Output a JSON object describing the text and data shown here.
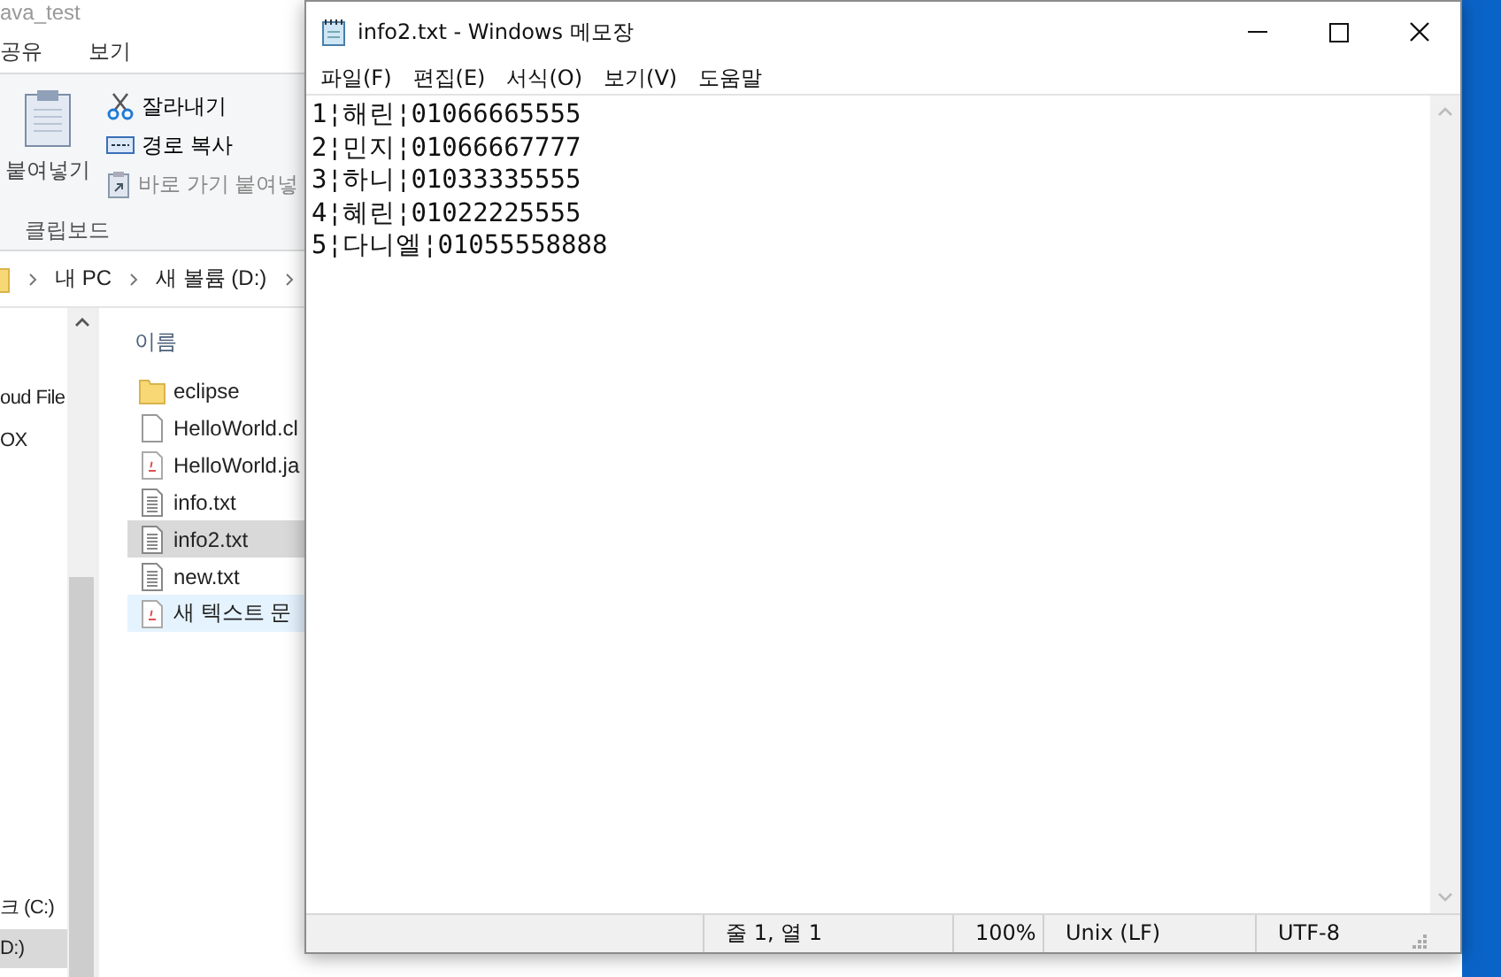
{
  "explorer": {
    "title": "ava_test",
    "ribbon_tabs": [
      "공유",
      "보기"
    ],
    "clipboard": {
      "paste": "붙여넣기",
      "commands": [
        {
          "label": "잘라내기",
          "kind": "cut",
          "disabled": false
        },
        {
          "label": "경로 복사",
          "kind": "copy-path",
          "disabled": false
        },
        {
          "label": "바로 가기 붙여넣",
          "kind": "paste-shortcut",
          "disabled": true
        }
      ],
      "group_label": "클립보드"
    },
    "address": [
      "내 PC",
      "새 볼륨 (D:)"
    ],
    "nav_items": [
      {
        "label": "oud File",
        "selected": false
      },
      {
        "label": "OX",
        "selected": false
      },
      {
        "label": "크 (C:)",
        "selected": false
      },
      {
        "label": "D:)",
        "selected": true
      }
    ],
    "column": "이름",
    "files": [
      {
        "name": "eclipse",
        "kind": "folder",
        "selected": false,
        "hovered": false
      },
      {
        "name": "HelloWorld.cl",
        "kind": "blank",
        "selected": false,
        "hovered": false
      },
      {
        "name": "HelloWorld.ja",
        "kind": "java",
        "selected": false,
        "hovered": false
      },
      {
        "name": "info.txt",
        "kind": "text",
        "selected": false,
        "hovered": false
      },
      {
        "name": "info2.txt",
        "kind": "text",
        "selected": true,
        "hovered": false
      },
      {
        "name": "new.txt",
        "kind": "text",
        "selected": false,
        "hovered": false
      },
      {
        "name": "새 텍스트 문",
        "kind": "java",
        "selected": false,
        "hovered": true
      }
    ]
  },
  "notepad": {
    "title": "info2.txt - Windows 메모장",
    "menu": [
      "파일(F)",
      "편집(E)",
      "서식(O)",
      "보기(V)",
      "도움말"
    ],
    "lines": [
      "1¦해린¦01066665555",
      "2¦민지¦01066667777",
      "3¦하니¦01033335555",
      "4¦혜린¦01022225555",
      "5¦다니엘¦01055558888"
    ],
    "status": [
      "줄 1, 열 1",
      "100%",
      "Unix (LF)",
      "UTF-8"
    ]
  }
}
